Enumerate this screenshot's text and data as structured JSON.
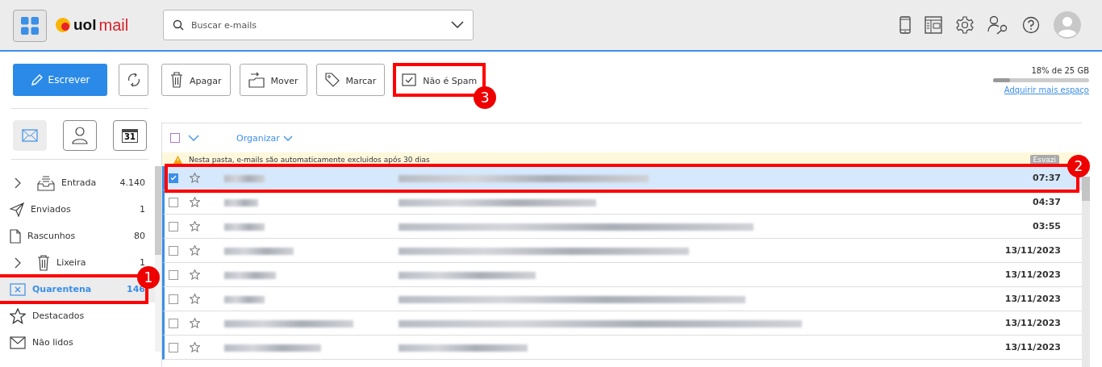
{
  "header": {
    "search": {
      "placeholder": "Buscar e-mails"
    },
    "logo": {
      "brand": "uol",
      "product": "mail"
    }
  },
  "toolbar": {
    "compose": "Escrever",
    "actions": [
      {
        "kind": "delete",
        "label": "Apagar"
      },
      {
        "kind": "move",
        "label": "Mover"
      },
      {
        "kind": "tag",
        "label": "Marcar"
      },
      {
        "kind": "notspam",
        "label": "Não é Spam",
        "callout": "3"
      }
    ]
  },
  "storage": {
    "text": "18% de 25 GB",
    "level": 0.18,
    "link": "Adquirir mais espaço"
  },
  "sidebar": {
    "tabs": [
      {
        "kind": "mail",
        "selected": true
      },
      {
        "kind": "contacts",
        "selected": false
      },
      {
        "kind": "calendar",
        "selected": false,
        "label": "31"
      }
    ],
    "folders": [
      {
        "kind": "inbox",
        "name": "Entrada",
        "count": "4.140",
        "expandable": true,
        "selected": false
      },
      {
        "kind": "sent",
        "name": "Enviados",
        "count": "1",
        "expandable": false,
        "selected": false
      },
      {
        "kind": "drafts",
        "name": "Rascunhos",
        "count": "80",
        "expandable": false,
        "selected": false
      },
      {
        "kind": "trash",
        "name": "Lixeira",
        "count": "1",
        "expandable": true,
        "selected": false
      },
      {
        "kind": "quarantine",
        "name": "Quarentena",
        "count": "146",
        "expandable": false,
        "selected": true,
        "callout": "1"
      },
      {
        "kind": "starred",
        "name": "Destacados",
        "expandable": false,
        "selected": false
      },
      {
        "kind": "unread",
        "name": "Não lidos",
        "expandable": false,
        "selected": false
      }
    ]
  },
  "list": {
    "select_all": {
      "checked": false
    },
    "organize": "Organizar",
    "notice": "Nesta pasta, e-mails são automaticamente excluidos após 30 dias",
    "empty_button": "Esvazi",
    "rows": [
      {
        "time": "07:37",
        "selected": true,
        "callout": "2"
      },
      {
        "time": "04:37",
        "selected": false
      },
      {
        "time": "03:55",
        "selected": false
      },
      {
        "time": "13/11/2023",
        "selected": false
      },
      {
        "time": "13/11/2023",
        "selected": false
      },
      {
        "time": "13/11/2023",
        "selected": false
      },
      {
        "time": "13/11/2023",
        "selected": false
      },
      {
        "time": "13/11/2023",
        "selected": false
      }
    ]
  }
}
